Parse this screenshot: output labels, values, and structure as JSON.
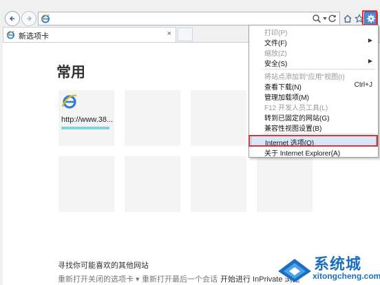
{
  "tab": {
    "title": "新选项卡",
    "close": "×"
  },
  "page": {
    "heading": "常用",
    "tile1_url": "http://www.38...",
    "discover": "寻找你可能喜欢的其他网站",
    "reopen_closed": "重新打开关闭的选项卡 ▾",
    "reopen_session": "重新打开最后一个会话",
    "inprivate": "开始进行 InPrivate 浏览"
  },
  "menu": {
    "items": [
      {
        "label": "打印(P)",
        "disabled": true
      },
      {
        "label": "文件(F)",
        "submenu": "▶"
      },
      {
        "label": "缩放(Z)",
        "disabled": true
      },
      {
        "label": "安全(S)",
        "submenu": "▶"
      },
      {
        "label": "将站点添加到\"应用\"视图(I)",
        "disabled": true
      },
      {
        "label": "查看下载(N)",
        "shortcut": "Ctrl+J"
      },
      {
        "label": "管理加载项(M)"
      },
      {
        "label": "F12 开发人员工具(L)",
        "disabled": true
      },
      {
        "label": "转到已固定的网站(G)"
      },
      {
        "label": "兼容性视图设置(B)"
      },
      {
        "label": "Internet 选项(O)",
        "selected": true
      },
      {
        "label": "关于 Internet Explorer(A)"
      }
    ]
  },
  "watermark": {
    "title": "系统城",
    "url": "xitongcheng.com"
  }
}
